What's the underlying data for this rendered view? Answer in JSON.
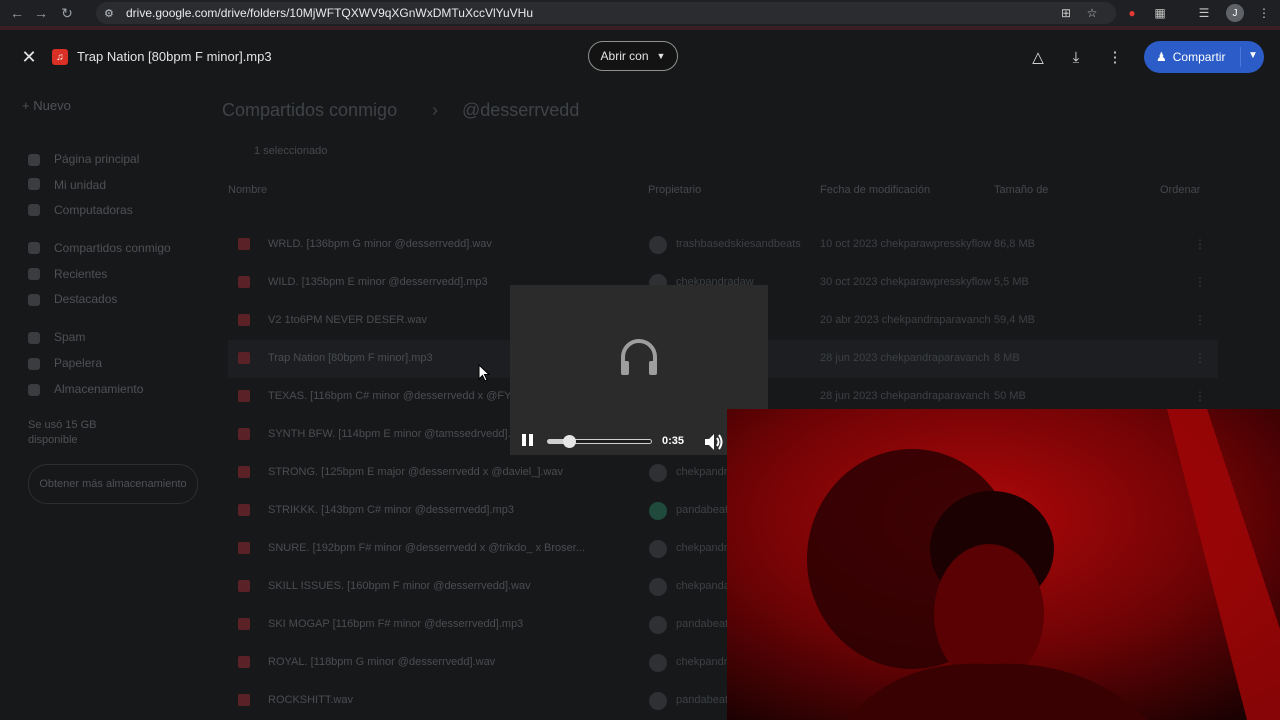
{
  "browser": {
    "url": "drive.google.com/drive/folders/10MjWFTQXWV9qXGnWxDMTuXccVlYuVHu",
    "profile_initial": "J"
  },
  "drive_bg": {
    "new_label": "Nuevo",
    "sidebar": [
      "Página principal",
      "Mi unidad",
      "Computadoras",
      "Compartidos conmigo",
      "Recientes",
      "Destacados",
      "Spam",
      "Papelera",
      "Almacenamiento"
    ],
    "storage_text": "Se usó 15 GB disponible",
    "storage_button": "Obtener más almacenamiento",
    "breadcrumb_1": "Compartidos conmigo",
    "breadcrumb_2": "@desserrvedd",
    "selection_label": "1 seleccionado",
    "columns": {
      "name": "Nombre",
      "owner": "Propietario",
      "date": "Fecha de modificación",
      "size": "Tamaño de",
      "sort": "Ordenar"
    },
    "files": [
      {
        "name": "WRLD. [136bpm G minor @desserrvedd].wav",
        "owner": "trashbasedskiesandbeats",
        "date": "10 oct 2023 chekparawpresskyflow",
        "size": "86,8 MB"
      },
      {
        "name": "WILD. [135bpm E minor @desserrvedd].mp3",
        "owner": "chekpandradaw",
        "date": "30 oct 2023 chekparawpresskyflow",
        "size": "5,5 MB"
      },
      {
        "name": "V2 1to6PM NEVER DESER.wav",
        "owner": "hakrow",
        "date": "20 abr 2023 chekpandraparavanch",
        "size": "59,4 MB"
      },
      {
        "name": "Trap Nation [80bpm F minor].mp3",
        "owner": "yo",
        "date": "28 jun 2023 chekpandraparavanch",
        "size": "8 MB"
      },
      {
        "name": "TEXAS. [116bpm C# minor @desserrvedd x @FY...",
        "owner": "chekpandra",
        "date": "28 jun 2023 chekpandraparavanch",
        "size": "50 MB"
      },
      {
        "name": "SYNTH BFW. [114bpm E minor @tamssedrvedd].wav",
        "owner": "tamssed",
        "date": "",
        "size": ""
      },
      {
        "name": "STRONG. [125bpm E major @desserrvedd x @daviel_].wav",
        "owner": "chekpandr",
        "date": "",
        "size": ""
      },
      {
        "name": "STRIKKK. [143bpm C# minor @desserrvedd].mp3",
        "owner": "pandabeat",
        "date": "",
        "size": ""
      },
      {
        "name": "SNURE. [192bpm F# minor @desserrvedd x @trikdo_ x Broser...",
        "owner": "chekpandr",
        "date": "",
        "size": ""
      },
      {
        "name": "SKILL ISSUES. [160bpm F minor @desserrvedd].wav",
        "owner": "chekpanda",
        "date": "",
        "size": ""
      },
      {
        "name": "SKI MOGAP [116bpm F# minor @desserrvedd].mp3",
        "owner": "pandabeat",
        "date": "",
        "size": ""
      },
      {
        "name": "ROYAL. [118bpm G minor @desserrvedd].wav",
        "owner": "chekpandr",
        "date": "",
        "size": ""
      },
      {
        "name": "ROCKSHITT.wav",
        "owner": "pandabeat",
        "date": "",
        "size": ""
      }
    ]
  },
  "preview": {
    "title": "Trap Nation [80bpm F minor].mp3",
    "open_with": "Abrir con",
    "share": "Compartir"
  },
  "player": {
    "time": "0:35",
    "progress": 0.2
  },
  "colors": {
    "share_blue": "#2b5cc8",
    "audio_file_red": "#d93025",
    "webcam_red": "#c40a0c"
  }
}
